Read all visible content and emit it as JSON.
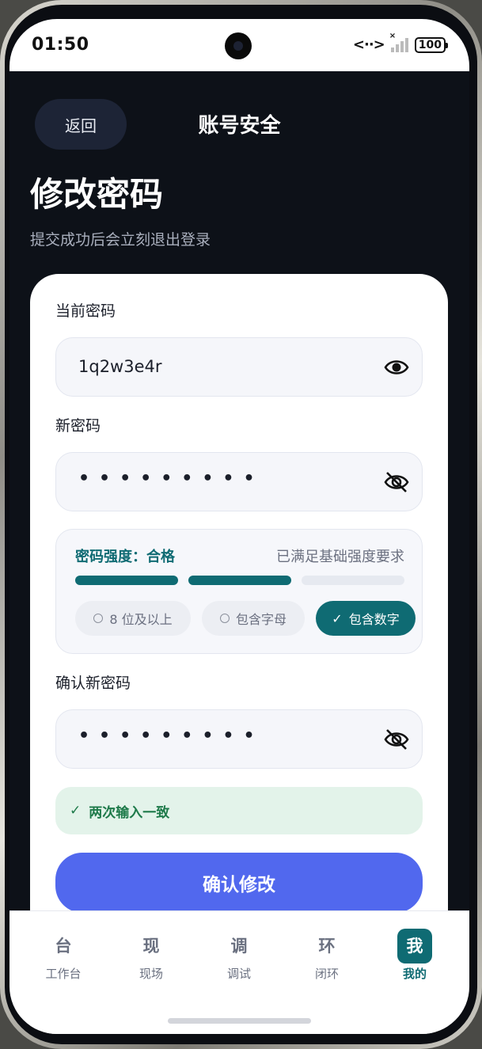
{
  "status_bar": {
    "time": "01:50",
    "battery": "100",
    "network_symbol": "<··>",
    "signal_x": "×"
  },
  "header": {
    "back_label": "返回",
    "nav_title": "账号安全",
    "page_title": "修改密码",
    "page_subtitle": "提交成功后会立刻退出登录"
  },
  "form": {
    "current_password": {
      "label": "当前密码",
      "value": "1q2w3e4r",
      "visible": true
    },
    "new_password": {
      "label": "新密码",
      "masked_value": "•••••••••",
      "visible": false
    },
    "strength": {
      "title": "密码强度：合格",
      "note": "已满足基础强度要求",
      "level": 2,
      "max_level": 3,
      "active_color": "#0f6b73",
      "inactive_color": "#e6e9f0",
      "checks": [
        {
          "label": "8 位及以上",
          "met": false
        },
        {
          "label": "包含字母",
          "met": false
        },
        {
          "label": "包含数字",
          "met": true
        }
      ]
    },
    "confirm_password": {
      "label": "确认新密码",
      "masked_value": "•••••••••",
      "visible": false
    },
    "match_message": "两次输入一致",
    "match_icon": "✓",
    "submit_label": "确认修改"
  },
  "tabbar": {
    "items": [
      {
        "glyph": "台",
        "label": "工作台",
        "active": false
      },
      {
        "glyph": "现",
        "label": "现场",
        "active": false
      },
      {
        "glyph": "调",
        "label": "调试",
        "active": false
      },
      {
        "glyph": "环",
        "label": "闭环",
        "active": false
      },
      {
        "glyph": "我",
        "label": "我的",
        "active": true
      }
    ]
  },
  "colors": {
    "accent_teal": "#0f6b73",
    "submit_blue": "#5168ee",
    "success_green": "#1e7a4a",
    "screen_dark": "#0d1118"
  }
}
